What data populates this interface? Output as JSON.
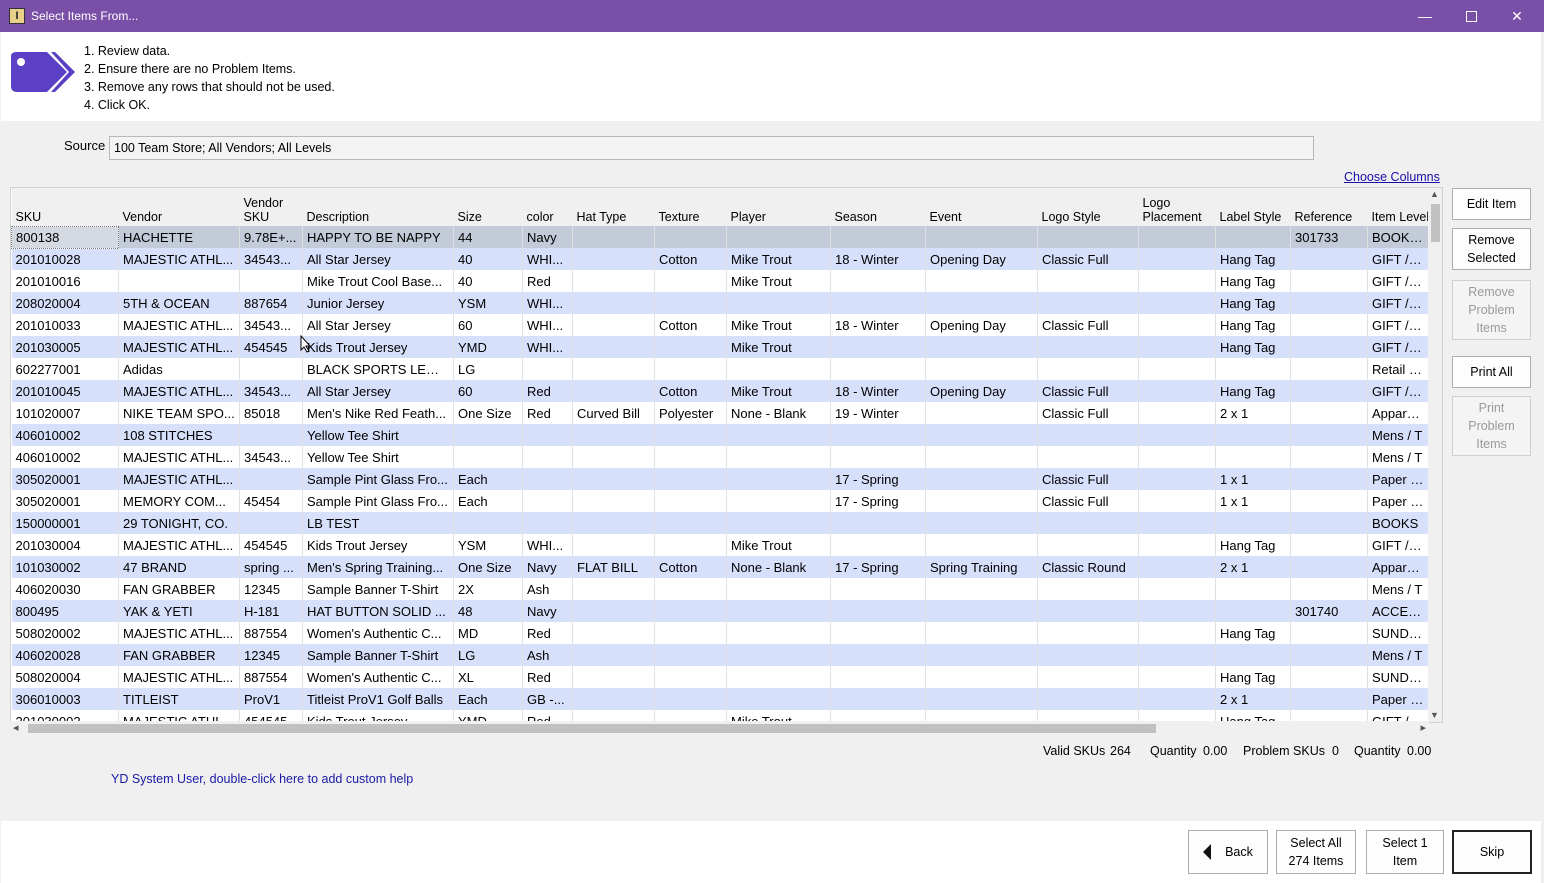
{
  "window": {
    "title": "Select Items From..."
  },
  "instructions": [
    "1. Review data.",
    "2. Ensure there are no Problem Items.",
    "3. Remove any rows that should not be used.",
    "4. Click OK."
  ],
  "source": {
    "label": "Source",
    "value": "100 Team Store; All Vendors; All Levels"
  },
  "choose_columns": "Choose Columns",
  "columns": [
    "SKU",
    "Vendor",
    "Vendor SKU",
    "Description",
    "Size",
    "color",
    "Hat Type",
    "Texture",
    "Player",
    "Season",
    "Event",
    "Logo Style",
    "Logo Placement",
    "Label Style",
    "Reference",
    "Item Level"
  ],
  "rows": [
    [
      "800138",
      "HACHETTE",
      "9.78E+...",
      "HAPPY TO BE NAPPY",
      "44",
      "Navy",
      "",
      "",
      "",
      "",
      "",
      "",
      "",
      "",
      "301733",
      "BOOKS /"
    ],
    [
      "201010028",
      "MAJESTIC ATHL...",
      "34543...",
      "All Star Jersey",
      "40",
      "WHI...",
      "",
      "Cotton",
      "Mike Trout",
      "18 - Winter",
      "Opening Day",
      "Classic Full",
      "",
      "Hang Tag",
      "",
      "GIFT / Au"
    ],
    [
      "201010016",
      "",
      "",
      "Mike Trout Cool Base...",
      "40",
      "Red",
      "",
      "",
      "Mike Trout",
      "",
      "",
      "",
      "",
      "Hang Tag",
      "",
      "GIFT / Au"
    ],
    [
      "208020004",
      "5TH & OCEAN",
      "887654",
      "Junior Jersey",
      "YSM",
      "WHI...",
      "",
      "",
      "",
      "",
      "",
      "",
      "",
      "Hang Tag",
      "",
      "GIFT / Ot"
    ],
    [
      "201010033",
      "MAJESTIC ATHL...",
      "34543...",
      "All Star Jersey",
      "60",
      "WHI...",
      "",
      "Cotton",
      "Mike Trout",
      "18 - Winter",
      "Opening Day",
      "Classic Full",
      "",
      "Hang Tag",
      "",
      "GIFT / Au"
    ],
    [
      "201030005",
      "MAJESTIC ATHL...",
      "454545",
      "Kids Trout Jersey",
      "YMD",
      "WHI...",
      "",
      "",
      "Mike Trout",
      "",
      "",
      "",
      "",
      "Hang Tag",
      "",
      "GIFT / Au"
    ],
    [
      "602277001",
      "Adidas",
      "",
      "BLACK SPORTS LEGG...",
      "LG",
      "",
      "",
      "",
      "",
      "",
      "",
      "",
      "",
      "",
      "",
      "Retail / Cl"
    ],
    [
      "201010045",
      "MAJESTIC ATHL...",
      "34543...",
      "All Star Jersey",
      "60",
      "Red",
      "",
      "Cotton",
      "Mike Trout",
      "18 - Winter",
      "Opening Day",
      "Classic Full",
      "",
      "Hang Tag",
      "",
      "GIFT / Au"
    ],
    [
      "101020007",
      "NIKE TEAM SPO...",
      "85018",
      "Men's Nike Red Feath...",
      "One Size",
      "Red",
      "Curved Bill",
      "Polyester",
      "None - Blank",
      "19 - Winter",
      "",
      "Classic Full",
      "",
      "2 x 1",
      "",
      "Apparel /"
    ],
    [
      "406010002",
      "108 STITCHES",
      "",
      "Yellow Tee Shirt",
      "",
      "",
      "",
      "",
      "",
      "",
      "",
      "",
      "",
      "",
      "",
      "Mens / T"
    ],
    [
      "406010002",
      "MAJESTIC ATHL...",
      "34543...",
      "Yellow Tee Shirt",
      "",
      "",
      "",
      "",
      "",
      "",
      "",
      "",
      "",
      "",
      "",
      "Mens / T"
    ],
    [
      "305020001",
      "MAJESTIC ATHL...",
      "",
      "Sample Pint Glass Fro...",
      "Each",
      "",
      "",
      "",
      "",
      "17 - Spring",
      "",
      "Classic Full",
      "",
      "1 x 1",
      "",
      "Paper / G"
    ],
    [
      "305020001",
      "MEMORY COM...",
      "45454",
      "Sample Pint Glass Fro...",
      "Each",
      "",
      "",
      "",
      "",
      "17 - Spring",
      "",
      "Classic Full",
      "",
      "1 x 1",
      "",
      "Paper / G"
    ],
    [
      "150000001",
      "29 TONIGHT, CO.",
      "",
      "LB TEST",
      "",
      "",
      "",
      "",
      "",
      "",
      "",
      "",
      "",
      "",
      "",
      "BOOKS"
    ],
    [
      "201030004",
      "MAJESTIC ATHL...",
      "454545",
      "Kids Trout Jersey",
      "YSM",
      "WHI...",
      "",
      "",
      "Mike Trout",
      "",
      "",
      "",
      "",
      "Hang Tag",
      "",
      "GIFT / Au"
    ],
    [
      "101030002",
      "47 BRAND",
      "spring ...",
      "Men's Spring Training...",
      "One Size",
      "Navy",
      "FLAT BILL",
      "Cotton",
      "None - Blank",
      "17 - Spring",
      "Spring Training",
      "Classic Round",
      "",
      "2 x 1",
      "",
      "Apparel /"
    ],
    [
      "406020030",
      "FAN GRABBER",
      "12345",
      "Sample Banner T-Shirt",
      "2X",
      "Ash",
      "",
      "",
      "",
      "",
      "",
      "",
      "",
      "",
      "",
      "Mens / T"
    ],
    [
      "800495",
      "YAK & YETI",
      "H-181",
      "HAT BUTTON SOLID ...",
      "48",
      "Navy",
      "",
      "",
      "",
      "",
      "",
      "",
      "",
      "",
      "301740",
      "ACCESSO"
    ],
    [
      "508020002",
      "MAJESTIC ATHL...",
      "887554",
      "Women's Authentic C...",
      "MD",
      "Red",
      "",
      "",
      "",
      "",
      "",
      "",
      "",
      "Hang Tag",
      "",
      "SUNDRIE"
    ],
    [
      "406020028",
      "FAN GRABBER",
      "12345",
      "Sample Banner T-Shirt",
      "LG",
      "Ash",
      "",
      "",
      "",
      "",
      "",
      "",
      "",
      "",
      "",
      "Mens / T"
    ],
    [
      "508020004",
      "MAJESTIC ATHL...",
      "887554",
      "Women's Authentic C...",
      "XL",
      "Red",
      "",
      "",
      "",
      "",
      "",
      "",
      "",
      "Hang Tag",
      "",
      "SUNDRIE"
    ],
    [
      "306010003",
      "TITLEIST",
      "ProV1",
      "Titleist ProV1 Golf Balls",
      "Each",
      "GB -...",
      "",
      "",
      "",
      "",
      "",
      "",
      "",
      "2 x 1",
      "",
      "Paper / G"
    ],
    [
      "201030002",
      "MAJESTIC ATHL...",
      "454545",
      "Kids Trout Jersey",
      "YMD",
      "Red",
      "",
      "",
      "Mike Trout",
      "",
      "",
      "",
      "",
      "Hang Tag",
      "",
      "GIFT / Au"
    ]
  ],
  "side_buttons": {
    "edit_item": "Edit Item",
    "remove_selected": "Remove Selected",
    "remove_problem": "Remove Problem Items",
    "print_all": "Print All",
    "print_problem": "Print Problem Items"
  },
  "status": {
    "valid_label": "Valid SKUs",
    "valid_value": "264",
    "qty_label_1": "Quantity",
    "qty_value_1": "0.00",
    "problem_label": "Problem SKUs",
    "problem_value": "0",
    "qty_label_2": "Quantity",
    "qty_value_2": "0.00"
  },
  "help_link": "YD System User, double-click here to add custom help",
  "footer": {
    "back": "Back",
    "select_all_line1": "Select All",
    "select_all_line2": "274 Items",
    "select_one_line1": "Select 1",
    "select_one_line2": "Item",
    "skip": "Skip"
  },
  "colors": {
    "titlebar": "#7a4fa8",
    "row_alt": "#d7e0fb",
    "link": "#1a0dab",
    "tag_icon": "#5b3fc4"
  }
}
